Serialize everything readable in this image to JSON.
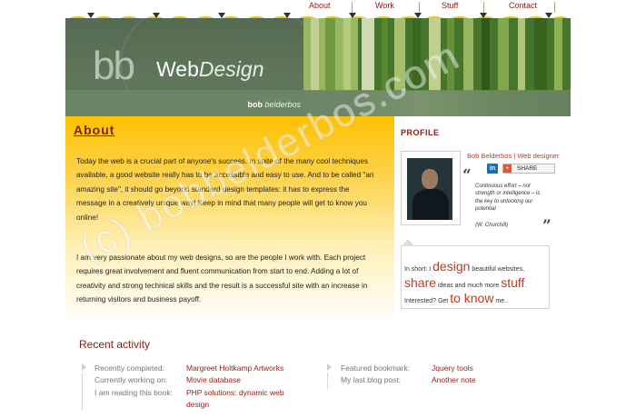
{
  "nav": {
    "items": [
      {
        "label": "About"
      },
      {
        "label": "Work"
      },
      {
        "label": "Stuff"
      },
      {
        "label": "Contact"
      }
    ]
  },
  "header": {
    "logo_mark": "bb",
    "title_bold": "Web",
    "title_italic": "Design",
    "name_first": "bob",
    "name_last": "belderbos"
  },
  "about": {
    "heading": "About",
    "paragraph1": "Today the web is a crucial part of anyone's success. In spite of the many cool techniques available, a good website really has to be accessible and easy to use. And to be called \"an amazing site\", it should go beyond standard design templates: it has to express the message in a creatively unique way! Keep in mind that many people will get to know you online!",
    "paragraph2": "I am very passionate about my web designs, so are the people I work with. Each project requires great involvement and fluent communication from start to end. Adding a lot of creativity and strong technical skills and the result is a successful site with an increase in returning visitors and business payoff."
  },
  "profile": {
    "heading": "PROFILE",
    "name_role": "Bob Belderbos | Web designer",
    "linkedin_label": "in",
    "share_label": "SHARE",
    "quote": "Continuous effort – not strength or intelligence – is the key to unlocking our potential",
    "quote_author": "(W. Churchill)",
    "in_short": {
      "prefix": "In short: I",
      "kw1": "design",
      "t1": " beautiful websites,",
      "kw2": "share",
      "t2": " ideas and much more ",
      "kw3": "stuff",
      "t3": ".",
      "t4": "Interested? Get ",
      "kw4": "to know",
      "t5": " me.."
    }
  },
  "recent": {
    "heading": "Recent activity",
    "left": [
      {
        "label": "Recently completed:",
        "value": "Margreet Holtkamp Artworks"
      },
      {
        "label": "Currently working on:",
        "value": "Movie database"
      },
      {
        "label": "I am reading this book:",
        "value": "PHP solutions: dynamic web",
        "value2": "design"
      }
    ],
    "right": [
      {
        "label": "Featured bookmark:",
        "value": "Jquery tools"
      },
      {
        "label": "My last blog post:",
        "value": "Another note"
      }
    ]
  },
  "watermark": "(c) bobbelderbos.com",
  "colors": {
    "accent_red": "#8a1a10",
    "keyword_red": "#c23a1b",
    "yellow": "#fdc000"
  }
}
